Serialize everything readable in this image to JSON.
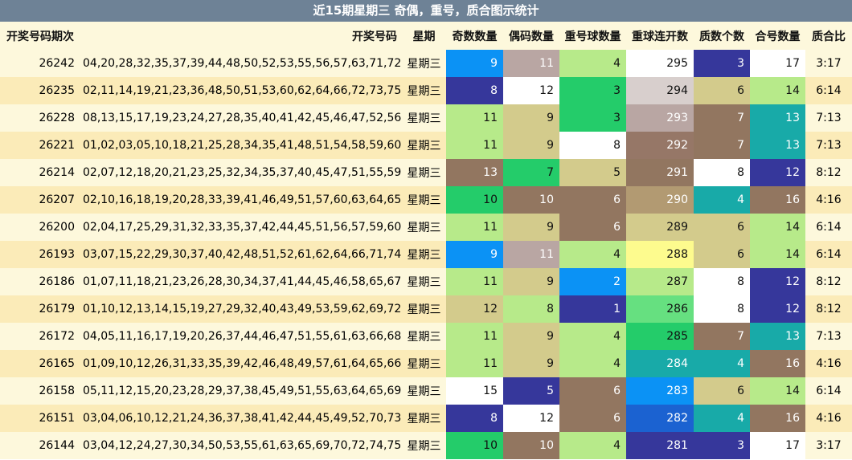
{
  "title": "近15期星期三 奇偶，重号，质合图示统计",
  "headers": [
    "开奖号码期次",
    "开奖号码",
    "星期",
    "奇数数量",
    "偶码数量",
    "重号球数量",
    "重球连开数",
    "质数个数",
    "合号数量",
    "质合比"
  ],
  "rows": [
    {
      "issue": "26242",
      "numbers": "04,20,28,32,35,37,39,44,48,50,52,53,55,56,57,63,71,72,76,77",
      "week": "星期三",
      "odd": "9",
      "even": "11",
      "repeat": "4",
      "streak": "295",
      "prime": "3",
      "composite": "17",
      "ratio": "3:17"
    },
    {
      "issue": "26235",
      "numbers": "02,11,14,19,21,23,36,48,50,51,53,60,62,64,66,72,73,75,78,80",
      "week": "星期三",
      "odd": "8",
      "even": "12",
      "repeat": "3",
      "streak": "294",
      "prime": "6",
      "composite": "14",
      "ratio": "6:14"
    },
    {
      "issue": "26228",
      "numbers": "08,13,15,17,19,23,24,27,28,35,40,41,42,45,46,47,52,56,67,80",
      "week": "星期三",
      "odd": "11",
      "even": "9",
      "repeat": "3",
      "streak": "293",
      "prime": "7",
      "composite": "13",
      "ratio": "7:13"
    },
    {
      "issue": "26221",
      "numbers": "01,02,03,05,10,18,21,25,28,34,35,41,48,51,54,58,59,60,77,79",
      "week": "星期三",
      "odd": "11",
      "even": "9",
      "repeat": "8",
      "streak": "292",
      "prime": "7",
      "composite": "13",
      "ratio": "7:13"
    },
    {
      "issue": "26214",
      "numbers": "02,07,12,18,20,21,23,25,32,34,35,37,40,45,47,51,55,59,61,71",
      "week": "星期三",
      "odd": "13",
      "even": "7",
      "repeat": "5",
      "streak": "291",
      "prime": "8",
      "composite": "12",
      "ratio": "8:12"
    },
    {
      "issue": "26207",
      "numbers": "02,10,16,18,19,20,28,33,39,41,46,49,51,57,60,63,64,65,71,76",
      "week": "星期三",
      "odd": "10",
      "even": "10",
      "repeat": "6",
      "streak": "290",
      "prime": "4",
      "composite": "16",
      "ratio": "4:16"
    },
    {
      "issue": "26200",
      "numbers": "02,04,17,25,29,31,32,33,35,37,42,44,45,51,56,57,59,60,64,66",
      "week": "星期三",
      "odd": "11",
      "even": "9",
      "repeat": "6",
      "streak": "289",
      "prime": "6",
      "composite": "14",
      "ratio": "6:14"
    },
    {
      "issue": "26193",
      "numbers": "03,07,15,22,29,30,37,40,42,48,51,52,61,62,64,66,71,74,75,78",
      "week": "星期三",
      "odd": "9",
      "even": "11",
      "repeat": "4",
      "streak": "288",
      "prime": "6",
      "composite": "14",
      "ratio": "6:14"
    },
    {
      "issue": "26186",
      "numbers": "01,07,11,18,21,23,26,28,30,34,37,41,44,45,46,58,65,67,71,80",
      "week": "星期三",
      "odd": "11",
      "even": "9",
      "repeat": "2",
      "streak": "287",
      "prime": "8",
      "composite": "12",
      "ratio": "8:12"
    },
    {
      "issue": "26179",
      "numbers": "01,10,12,13,14,15,19,27,29,32,40,43,49,53,59,62,69,72,73,80",
      "week": "星期三",
      "odd": "12",
      "even": "8",
      "repeat": "1",
      "streak": "286",
      "prime": "8",
      "composite": "12",
      "ratio": "8:12"
    },
    {
      "issue": "26172",
      "numbers": "04,05,11,16,17,19,20,26,37,44,46,47,51,55,61,63,66,68,70,75",
      "week": "星期三",
      "odd": "11",
      "even": "9",
      "repeat": "4",
      "streak": "285",
      "prime": "7",
      "composite": "13",
      "ratio": "7:13"
    },
    {
      "issue": "26165",
      "numbers": "01,09,10,12,26,31,33,35,39,42,46,48,49,57,61,64,65,66,67,74",
      "week": "星期三",
      "odd": "11",
      "even": "9",
      "repeat": "4",
      "streak": "284",
      "prime": "4",
      "composite": "16",
      "ratio": "4:16"
    },
    {
      "issue": "26158",
      "numbers": "05,11,12,15,20,23,28,29,37,38,45,49,51,55,63,64,65,69,77,79",
      "week": "星期三",
      "odd": "15",
      "even": "5",
      "repeat": "6",
      "streak": "283",
      "prime": "6",
      "composite": "14",
      "ratio": "6:14"
    },
    {
      "issue": "26151",
      "numbers": "03,04,06,10,12,21,24,36,37,38,41,42,44,45,49,52,70,73,77,78",
      "week": "星期三",
      "odd": "8",
      "even": "12",
      "repeat": "6",
      "streak": "282",
      "prime": "4",
      "composite": "16",
      "ratio": "4:16"
    },
    {
      "issue": "26144",
      "numbers": "03,04,12,24,27,30,34,50,53,55,61,63,65,69,70,72,74,75,76,77",
      "week": "星期三",
      "odd": "10",
      "even": "10",
      "repeat": "4",
      "streak": "281",
      "prime": "3",
      "composite": "17",
      "ratio": "3:17"
    }
  ],
  "colors": {
    "title_bg": "#6e8296",
    "header_bg": "#fdf8dc",
    "row_odd": "#fdf8dc",
    "row_even": "#fbebb8",
    "odd": {
      "8": "#36379b",
      "9": "#0b92f5",
      "10": "#24cc6a",
      "11": "#b7ea8a",
      "12": "#d3cb8c",
      "13": "#927660",
      "15": "#ffffff"
    },
    "even": {
      "5": "#36379b",
      "7": "#24cc6a",
      "8": "#b7ea8a",
      "9": "#d3cb8c",
      "10": "#927660",
      "11": "#b9a6a3",
      "12": "#ffffff"
    },
    "repeat": {
      "1": "#36379b",
      "2": "#0b92f5",
      "3": "#24cc6a",
      "4": "#b7ea8a",
      "5": "#d3cb8c",
      "6": "#927660",
      "8": "#ffffff"
    },
    "streak": {
      "281": "#36379b",
      "282": "#1b62d1",
      "283": "#0b92f5",
      "284": "#18aaa8",
      "285": "#24cc6a",
      "286": "#66e080",
      "287": "#b7ea8a",
      "288": "#fdfb8e",
      "289": "#d3cb8c",
      "290": "#b29a72",
      "291": "#927660",
      "292": "#967767",
      "293": "#b9a6a3",
      "294": "#d8cfcd",
      "295": "#ffffff"
    },
    "prime": {
      "3": "#36379b",
      "4": "#18aaa8",
      "6": "#d3cb8c",
      "7": "#927660",
      "8": "#ffffff"
    },
    "composite": {
      "12": "#36379b",
      "13": "#18aaa8",
      "14": "#b7ea8a",
      "16": "#927660",
      "17": "#ffffff"
    }
  }
}
